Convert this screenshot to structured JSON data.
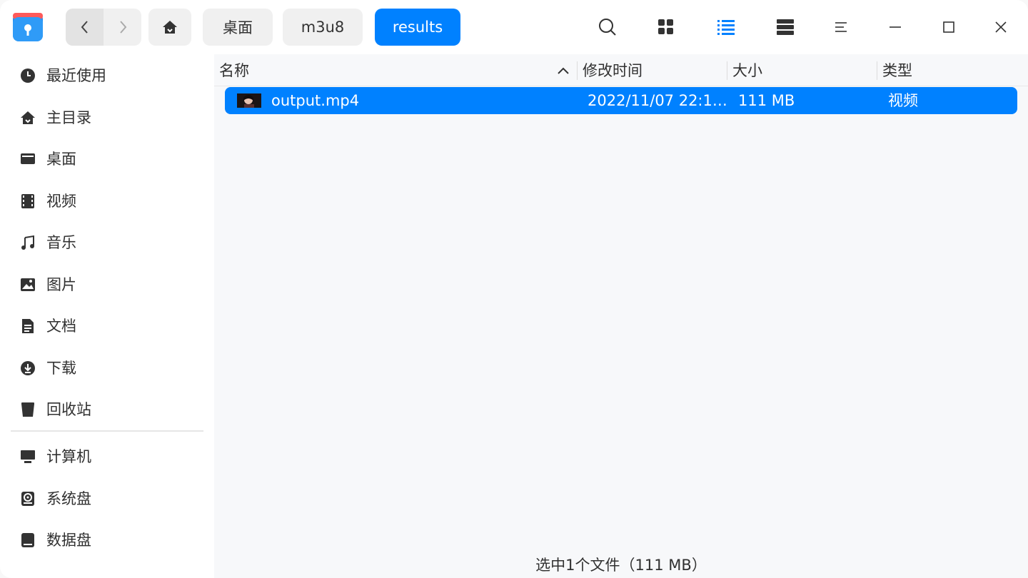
{
  "titlebar": {
    "breadcrumbs": [
      "桌面",
      "m3u8",
      "results"
    ],
    "icons": [
      "search-icon",
      "icon-view-icon",
      "list-view-icon",
      "detail-view-icon",
      "menu-icon",
      "minimize-icon",
      "maximize-icon",
      "close-icon"
    ]
  },
  "sidebar": {
    "items": [
      {
        "label": "最近使用",
        "icon": "clock-icon"
      },
      {
        "label": "主目录",
        "icon": "home-icon"
      },
      {
        "label": "桌面",
        "icon": "desktop-icon"
      },
      {
        "label": "视频",
        "icon": "video-icon"
      },
      {
        "label": "音乐",
        "icon": "music-icon"
      },
      {
        "label": "图片",
        "icon": "picture-icon"
      },
      {
        "label": "文档",
        "icon": "document-icon"
      },
      {
        "label": "下载",
        "icon": "download-icon"
      },
      {
        "label": "回收站",
        "icon": "trash-icon"
      }
    ],
    "devices": [
      {
        "label": "计算机",
        "icon": "computer-icon"
      },
      {
        "label": "系统盘",
        "icon": "system-disk-icon"
      },
      {
        "label": "数据盘",
        "icon": "data-disk-icon"
      }
    ]
  },
  "table": {
    "headers": [
      "名称",
      "修改时间",
      "大小",
      "类型"
    ],
    "rows": [
      {
        "name": "output.mp4",
        "modified": "2022/11/07 22:1…",
        "size": "111 MB",
        "type": "视频"
      }
    ]
  },
  "status": {
    "text": "选中1个文件（111 MB）"
  },
  "colors": {
    "accent": "#0081ff",
    "selected_text": "#ffffff"
  }
}
